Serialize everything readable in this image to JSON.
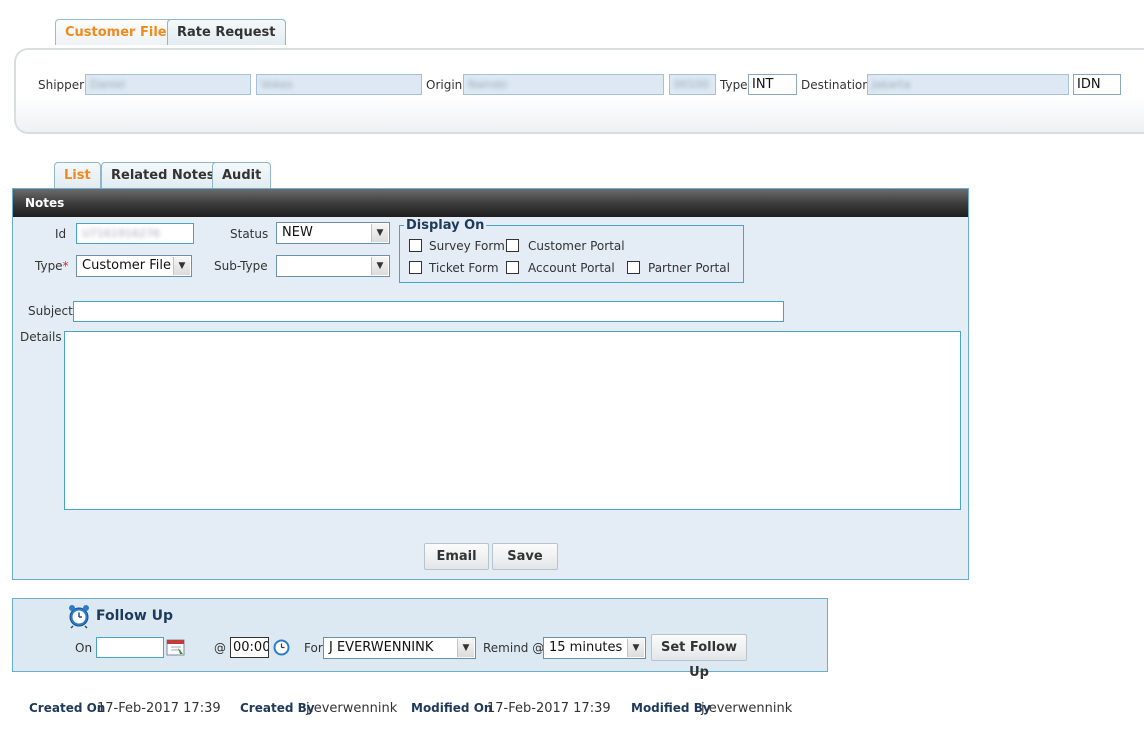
{
  "tabs": [
    {
      "label": "Customer File",
      "active": true
    },
    {
      "label": "Rate Request",
      "active": false
    }
  ],
  "header": {
    "shipper_label": "Shipper",
    "shipper_first": "Daniel",
    "shipper_last": "Vokes",
    "origin_label": "Origin",
    "origin_city": "Nairobi",
    "origin_code": "00100",
    "type_label": "Type",
    "type_value": "INT",
    "destination_label": "Destination",
    "destination_city": "Jakarta",
    "destination_code": "IDN"
  },
  "sub_tabs": [
    {
      "label": "List",
      "active": true
    },
    {
      "label": "Related Notes",
      "active": false
    },
    {
      "label": "Audit",
      "active": false
    }
  ],
  "notes": {
    "title": "Notes",
    "id_label": "Id",
    "id_value": "U7161916276",
    "status_label": "Status",
    "status_value": "NEW",
    "type_label": "Type",
    "required_mark": "*",
    "type_value": "Customer File",
    "subtype_label": "Sub-Type",
    "subtype_value": "",
    "display_on": {
      "legend": "Display On",
      "options": [
        {
          "label": "Survey Form",
          "checked": false
        },
        {
          "label": "Customer Portal",
          "checked": false
        },
        {
          "label": "Ticket Form",
          "checked": false
        },
        {
          "label": "Account Portal",
          "checked": false
        },
        {
          "label": "Partner Portal",
          "checked": false
        }
      ]
    },
    "subject_label": "Subject",
    "subject_value": "",
    "details_label": "Details",
    "details_value": "",
    "email_button": "Email",
    "save_button": "Save"
  },
  "follow_up": {
    "title": "Follow Up",
    "on_label": "On",
    "on_value": "",
    "at_label": "@",
    "time_value": "00:00",
    "for_label": "For",
    "for_value": "J EVERWENNINK",
    "remind_label": "Remind @",
    "remind_value": "15 minutes",
    "set_button": "Set Follow Up"
  },
  "footer": {
    "created_on_label": "Created On",
    "created_on_value": "17-Feb-2017 17:39",
    "created_by_label": "Created By",
    "created_by_value": "j.everwennink",
    "modified_on_label": "Modified On",
    "modified_on_value": "17-Feb-2017 17:39",
    "modified_by_label": "Modified By",
    "modified_by_value": "j.everwennink"
  },
  "colors": {
    "accent_orange": "#f08a1c",
    "panel_blue": "#e4edf6",
    "border_teal": "#49a3c3",
    "header_dark": "#1e1e1e"
  }
}
